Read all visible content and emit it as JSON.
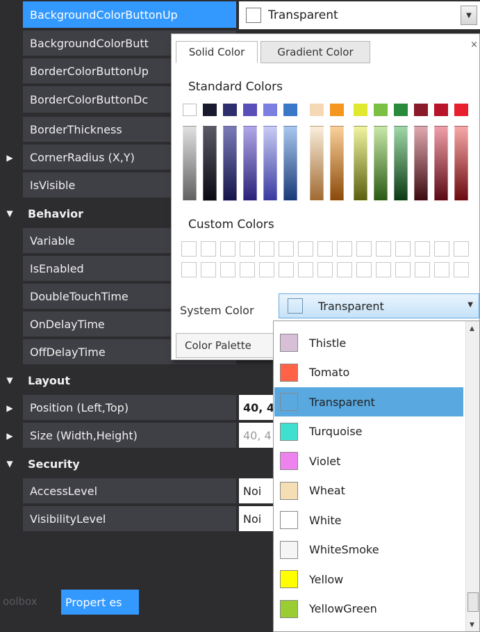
{
  "grid": {
    "rows": [
      {
        "kind": "prop",
        "name": "BackgroundColorButtonUp",
        "value": "",
        "expander": "",
        "selected": true
      },
      {
        "kind": "prop",
        "name": "BackgroundColorButt",
        "value": "",
        "expander": ""
      },
      {
        "kind": "prop",
        "name": "BorderColorButtonUp",
        "value": "",
        "expander": ""
      },
      {
        "kind": "prop",
        "name": "BorderColorButtonDc",
        "value": "",
        "expander": ""
      },
      {
        "kind": "prop",
        "name": "BorderThickness",
        "value": "",
        "expander": ""
      },
      {
        "kind": "prop",
        "name": "CornerRadius (X,Y)",
        "value": "",
        "expander": "▶"
      },
      {
        "kind": "prop",
        "name": "IsVisible",
        "value": "",
        "expander": ""
      },
      {
        "kind": "category",
        "name": "Behavior",
        "expander": "▼"
      },
      {
        "kind": "prop",
        "name": "Variable",
        "value": "",
        "expander": ""
      },
      {
        "kind": "prop",
        "name": "IsEnabled",
        "value": "",
        "expander": ""
      },
      {
        "kind": "prop",
        "name": "DoubleTouchTime",
        "value": "",
        "expander": ""
      },
      {
        "kind": "prop",
        "name": "OnDelayTime",
        "value": "",
        "expander": ""
      },
      {
        "kind": "prop",
        "name": "OffDelayTime",
        "value": "",
        "expander": ""
      },
      {
        "kind": "category",
        "name": "Layout",
        "expander": "▼"
      },
      {
        "kind": "prop",
        "name": "Position (Left,Top)",
        "value": "40, 4",
        "expander": "▶",
        "bold": true
      },
      {
        "kind": "prop",
        "name": "Size (Width,Height)",
        "value": "40, 4",
        "expander": "▶",
        "dim": true
      },
      {
        "kind": "category",
        "name": "Security",
        "expander": "▼"
      },
      {
        "kind": "prop",
        "name": "AccessLevel",
        "value": "Noi",
        "expander": ""
      },
      {
        "kind": "prop",
        "name": "VisibilityLevel",
        "value": "Noi",
        "expander": ""
      }
    ],
    "top_value": "Transparent"
  },
  "bottom_tabs": {
    "toolbox": "oolbox",
    "properties": "Propert es"
  },
  "popup": {
    "tab_solid": "Solid Color",
    "tab_gradient": "Gradient Color",
    "close": "×",
    "standard_title": "Standard Colors",
    "custom_title": "Custom Colors",
    "system_label": "System Color",
    "system_value": "Transparent",
    "palette_button": "Color Palette",
    "standard_colors": [
      "#ffffff",
      "#1a1a2e",
      "#2e2e6e",
      "#5a4fb8",
      "#7b7fe0",
      "#3a78c8",
      "#f5d9b5",
      "#f5961e",
      "#e0e830",
      "#7ac043",
      "#2a8a3c",
      "#8a1a2a",
      "#b8142a",
      "#e8202e"
    ],
    "shade_colors": [
      [
        "#e0e0e0",
        "#606060"
      ],
      [
        "#5a5a66",
        "#0a0a14"
      ],
      [
        "#7a7ab8",
        "#14144a"
      ],
      [
        "#b0a8e8",
        "#2a2078"
      ],
      [
        "#c8ccf4",
        "#3a3aa0"
      ],
      [
        "#a8c8ee",
        "#1a3a78"
      ],
      [
        "#faeedc",
        "#a06a30"
      ],
      [
        "#fbd09a",
        "#8a4a0a"
      ],
      [
        "#f0f4a0",
        "#5a6010"
      ],
      [
        "#c8e8a8",
        "#2a5a14"
      ],
      [
        "#a0d8a8",
        "#0a3a14"
      ],
      [
        "#e0a8b0",
        "#3a0a10"
      ],
      [
        "#f0a0a8",
        "#5a0a14"
      ],
      [
        "#f8a8a8",
        "#6a0a10"
      ]
    ]
  },
  "dropdown": {
    "items": [
      {
        "label": "Thistle",
        "color": "#d8bfd8"
      },
      {
        "label": "Tomato",
        "color": "#ff6347"
      },
      {
        "label": "Transparent",
        "color": "transparent",
        "selected": true
      },
      {
        "label": "Turquoise",
        "color": "#40e0d0"
      },
      {
        "label": "Violet",
        "color": "#ee82ee"
      },
      {
        "label": "Wheat",
        "color": "#f5deb3"
      },
      {
        "label": "White",
        "color": "#ffffff"
      },
      {
        "label": "WhiteSmoke",
        "color": "#f5f5f5"
      },
      {
        "label": "Yellow",
        "color": "#ffff00"
      },
      {
        "label": "YellowGreen",
        "color": "#9acd32"
      }
    ]
  }
}
